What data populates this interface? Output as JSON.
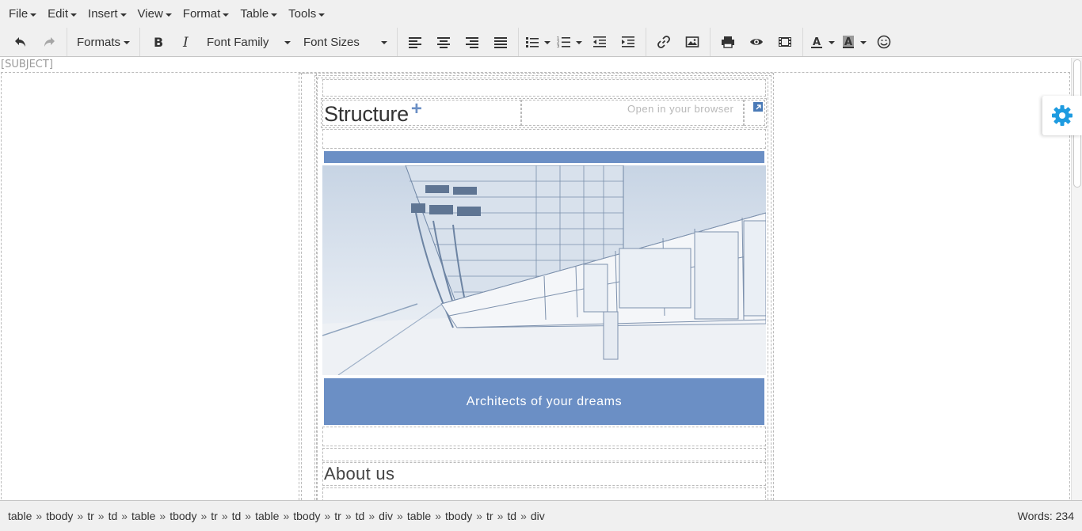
{
  "menubar": {
    "items": [
      "File",
      "Edit",
      "Insert",
      "View",
      "Format",
      "Table",
      "Tools"
    ]
  },
  "toolbar": {
    "formats_label": "Formats",
    "font_family_label": "Font Family",
    "font_sizes_label": "Font Sizes",
    "icons": [
      "undo-icon",
      "redo-icon",
      "bold-icon",
      "italic-icon",
      "align-left-icon",
      "align-center-icon",
      "align-right-icon",
      "align-justify-icon",
      "bullet-list-icon",
      "numbered-list-icon",
      "outdent-icon",
      "indent-icon",
      "link-icon",
      "image-icon",
      "print-icon",
      "preview-icon",
      "media-icon",
      "text-color-icon",
      "background-color-icon",
      "emoticons-icon"
    ]
  },
  "editor": {
    "subject": "[SUBJECT]",
    "brand": "Structure",
    "brand_plus": "+",
    "open_browser": "Open in your browser",
    "banner_text": "Architects of your dreams",
    "about_heading": "About us"
  },
  "statusbar": {
    "path": [
      "table",
      "tbody",
      "tr",
      "td",
      "table",
      "tbody",
      "tr",
      "td",
      "table",
      "tbody",
      "tr",
      "td",
      "div",
      "table",
      "tbody",
      "tr",
      "td",
      "div"
    ],
    "separator": "»",
    "word_count": "Words: 234"
  },
  "colors": {
    "accent_blue": "#6b8fc5",
    "gear_blue": "#1e9be0",
    "toolbar_bg": "#f0f0f0"
  }
}
